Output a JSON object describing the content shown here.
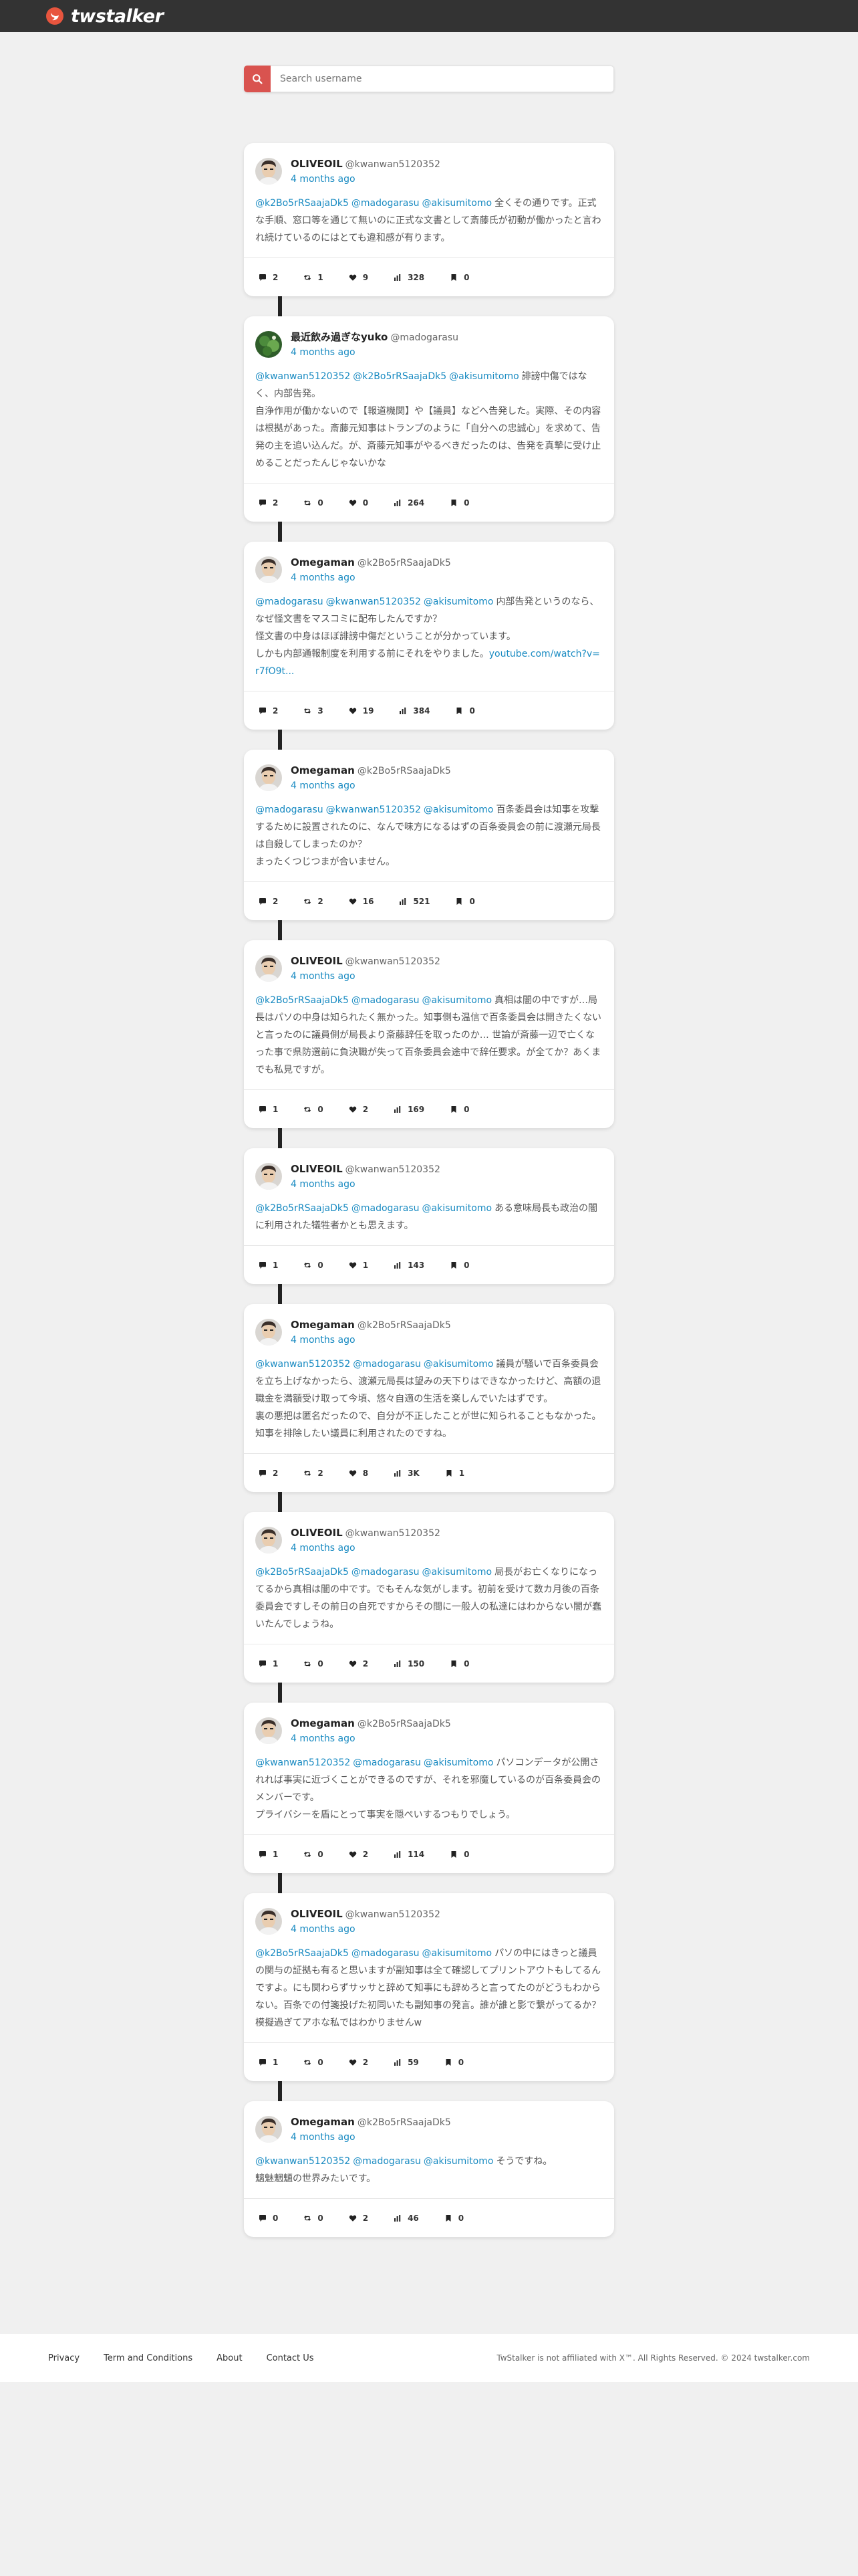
{
  "brand": {
    "name": "twstalker",
    "accent": "#e8553e"
  },
  "search": {
    "placeholder": "Search username"
  },
  "posts": [
    {
      "name": "OLIVEOIL",
      "handle": "@kwanwan5120352",
      "time": "4 months ago",
      "avatar": "face-icon",
      "mentions": [
        "@k2Bo5rRSaajaDk5",
        "@madogarasu",
        "@akisumitomo"
      ],
      "text": "全くその通りです。正式な手順、窓口等を通じて無いのに正式な文書として斎藤氏が初動が働かったと言われ続けているのにはとても違和感が有ります。",
      "link": "",
      "stats": {
        "replies": "2",
        "retweets": "1",
        "likes": "9",
        "views": "328",
        "bookmarks": "0"
      }
    },
    {
      "name": "最近飲み過ぎなyuko",
      "handle": "@madogarasu",
      "time": "4 months ago",
      "avatar": "plant-icon",
      "mentions": [
        "@kwanwan5120352",
        "@k2Bo5rRSaajaDk5",
        "@akisumitomo"
      ],
      "text": "誹謗中傷ではなく、内部告発。\n自浄作用が働かないので【報道機関】や【議員】などへ告発した。実際、その内容は根拠があった。斎藤元知事はトランプのように「自分への忠誠心」を求めて、告発の主を追い込んだ。が、斎藤元知事がやるべきだったのは、告発を真摯に受け止めることだったんじゃないかな",
      "link": "",
      "stats": {
        "replies": "2",
        "retweets": "0",
        "likes": "0",
        "views": "264",
        "bookmarks": "0"
      }
    },
    {
      "name": "Omegaman",
      "handle": "@k2Bo5rRSaajaDk5",
      "time": "4 months ago",
      "avatar": "face-icon",
      "mentions": [
        "@madogarasu",
        "@kwanwan5120352",
        "@akisumitomo"
      ],
      "text": "内部告発というのなら、なぜ怪文書をマスコミに配布したんですか？\n怪文書の中身はほぼ誹謗中傷だということが分かっています。\nしかも内部通報制度を利用する前にそれをやりました。",
      "link": "youtube.com/watch?v=r7fO9t...",
      "stats": {
        "replies": "2",
        "retweets": "3",
        "likes": "19",
        "views": "384",
        "bookmarks": "0"
      }
    },
    {
      "name": "Omegaman",
      "handle": "@k2Bo5rRSaajaDk5",
      "time": "4 months ago",
      "avatar": "face-icon",
      "mentions": [
        "@madogarasu",
        "@kwanwan5120352",
        "@akisumitomo"
      ],
      "text": "百条委員会は知事を攻撃するために設置されたのに、なんで味方になるはずの百条委員会の前に渡瀬元局長は自殺してしまったのか？\nまったくつじつまが合いません。",
      "link": "",
      "stats": {
        "replies": "2",
        "retweets": "2",
        "likes": "16",
        "views": "521",
        "bookmarks": "0"
      }
    },
    {
      "name": "OLIVEOIL",
      "handle": "@kwanwan5120352",
      "time": "4 months ago",
      "avatar": "face-icon",
      "mentions": [
        "@k2Bo5rRSaajaDk5",
        "@madogarasu",
        "@akisumitomo"
      ],
      "text": "真相は闇の中ですが…局長はパソの中身は知られたく無かった。知事側も温信で百条委員会は開きたくないと言ったのに議員側が局長より斎藤辞任を取ったのか… 世論が斎藤一辺で亡くなった事で県防選前に負決職が失って百条委員会途中で辞任要求。が全てか？あくまでも私見ですが。",
      "link": "",
      "stats": {
        "replies": "1",
        "retweets": "0",
        "likes": "2",
        "views": "169",
        "bookmarks": "0"
      }
    },
    {
      "name": "OLIVEOIL",
      "handle": "@kwanwan5120352",
      "time": "4 months ago",
      "avatar": "face-icon",
      "mentions": [
        "@k2Bo5rRSaajaDk5",
        "@madogarasu",
        "@akisumitomo"
      ],
      "text": "ある意味局長も政治の闇に利用された犠牲者かとも思えます。",
      "link": "",
      "stats": {
        "replies": "1",
        "retweets": "0",
        "likes": "1",
        "views": "143",
        "bookmarks": "0"
      }
    },
    {
      "name": "Omegaman",
      "handle": "@k2Bo5rRSaajaDk5",
      "time": "4 months ago",
      "avatar": "face-icon",
      "mentions": [
        "@kwanwan5120352",
        "@madogarasu",
        "@akisumitomo"
      ],
      "text": "議員が騒いで百条委員会を立ち上げなかったら、渡瀬元局長は望みの天下りはできなかったけど、高額の退職金を満額受け取って今頃、悠々自適の生活を楽しんでいたはずです。\n裏の悪把は匿名だったので、自分が不正したことが世に知られることもなかった。\n知事を排除したい議員に利用されたのですね。",
      "link": "",
      "stats": {
        "replies": "2",
        "retweets": "2",
        "likes": "8",
        "views": "3K",
        "bookmarks": "1"
      }
    },
    {
      "name": "OLIVEOIL",
      "handle": "@kwanwan5120352",
      "time": "4 months ago",
      "avatar": "face-icon",
      "mentions": [
        "@k2Bo5rRSaajaDk5",
        "@madogarasu",
        "@akisumitomo"
      ],
      "text": "局長がお亡くなりになってるから真相は闇の中です。でもそんな気がします。初前を受けて数カ月後の百条委員会ですしその前日の自死ですからその間に一般人の私達にはわからない闇が蠢いたんでしょうね。",
      "link": "",
      "stats": {
        "replies": "1",
        "retweets": "0",
        "likes": "2",
        "views": "150",
        "bookmarks": "0"
      }
    },
    {
      "name": "Omegaman",
      "handle": "@k2Bo5rRSaajaDk5",
      "time": "4 months ago",
      "avatar": "face-icon",
      "mentions": [
        "@kwanwan5120352",
        "@madogarasu",
        "@akisumitomo"
      ],
      "text": "パソコンデータが公開されれば事実に近づくことができるのですが、それを邪魔しているのが百条委員会のメンバーです。\nプライバシーを盾にとって事実を隠ぺいするつもりでしょう。",
      "link": "",
      "stats": {
        "replies": "1",
        "retweets": "0",
        "likes": "2",
        "views": "114",
        "bookmarks": "0"
      }
    },
    {
      "name": "OLIVEOIL",
      "handle": "@kwanwan5120352",
      "time": "4 months ago",
      "avatar": "face-icon",
      "mentions": [
        "@k2Bo5rRSaajaDk5",
        "@madogarasu",
        "@akisumitomo"
      ],
      "text": "パソの中にはきっと議員の関与の証拠も有ると思いますが副知事は全て確認してプリントアウトもしてるんですよ。にも関わらずサッサと辞めて知事にも辞めろと言ってたのがどうもわからない。百条での付箋投げた初同いたも副知事の発言。誰が誰と影で繋がってるか？模擬過ぎてアホな私ではわかりませんw",
      "link": "",
      "stats": {
        "replies": "1",
        "retweets": "0",
        "likes": "2",
        "views": "59",
        "bookmarks": "0"
      }
    },
    {
      "name": "Omegaman",
      "handle": "@k2Bo5rRSaajaDk5",
      "time": "4 months ago",
      "avatar": "face-icon",
      "mentions": [
        "@kwanwan5120352",
        "@madogarasu",
        "@akisumitomo"
      ],
      "text": "そうですね。\n魑魅魍魎の世界みたいです。",
      "link": "",
      "stats": {
        "replies": "0",
        "retweets": "0",
        "likes": "2",
        "views": "46",
        "bookmarks": "0"
      }
    }
  ],
  "footer": {
    "links": [
      "Privacy",
      "Term and Conditions",
      "About",
      "Contact Us"
    ],
    "copyright": "TwStalker is not affiliated with X™. All Rights Reserved. © 2024 twstalker.com"
  }
}
